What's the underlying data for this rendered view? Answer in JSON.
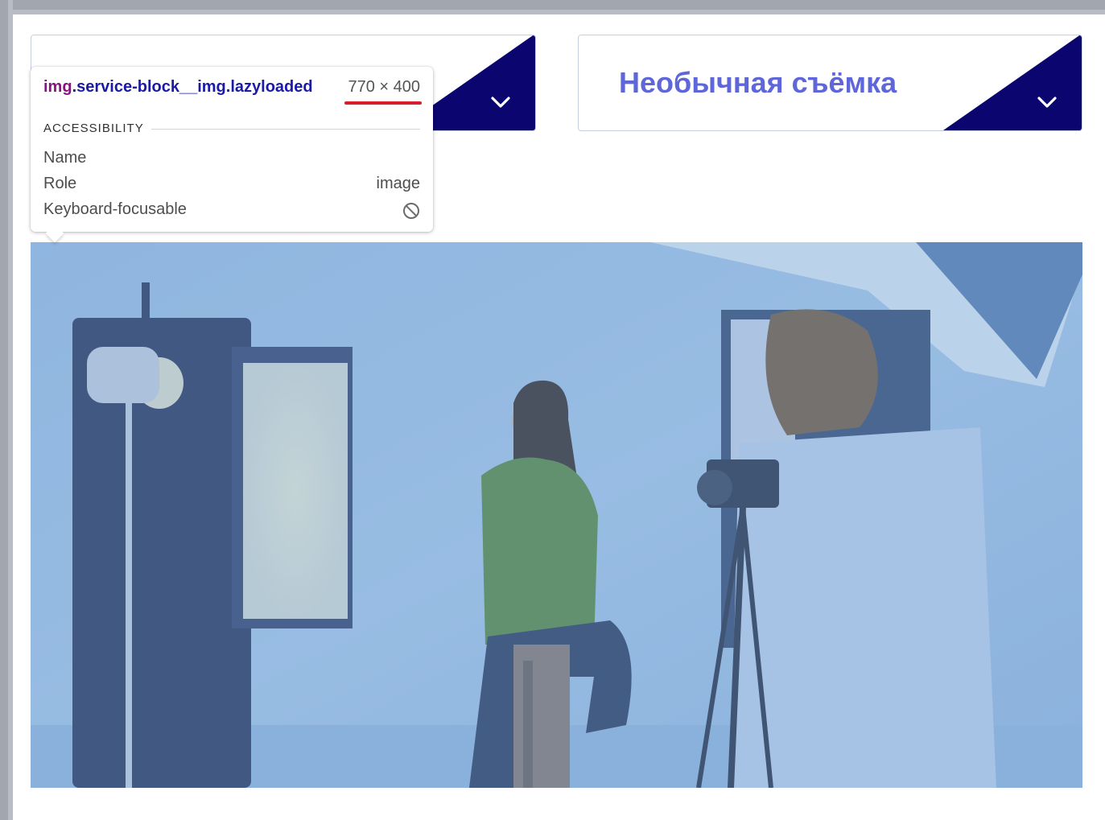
{
  "cards": [
    {
      "title": ""
    },
    {
      "title": "Необычная съёмка"
    }
  ],
  "tooltip": {
    "tag": "img",
    "class": ".service-block__img.lazyloaded",
    "dimensions": "770 × 400",
    "section": "ACCESSIBILITY",
    "rows": [
      {
        "label": "Name",
        "value": ""
      },
      {
        "label": "Role",
        "value": "image"
      },
      {
        "label": "Keyboard-focusable",
        "icon": "not-allowed-icon"
      }
    ]
  },
  "colors": {
    "card_accent": "#0b0570",
    "card_title": "#5e66d9",
    "photo_overlay": "#6a9fd4",
    "highlight_underline": "#d3202a"
  },
  "icons": [
    "chevron-down-icon",
    "not-allowed-icon"
  ]
}
